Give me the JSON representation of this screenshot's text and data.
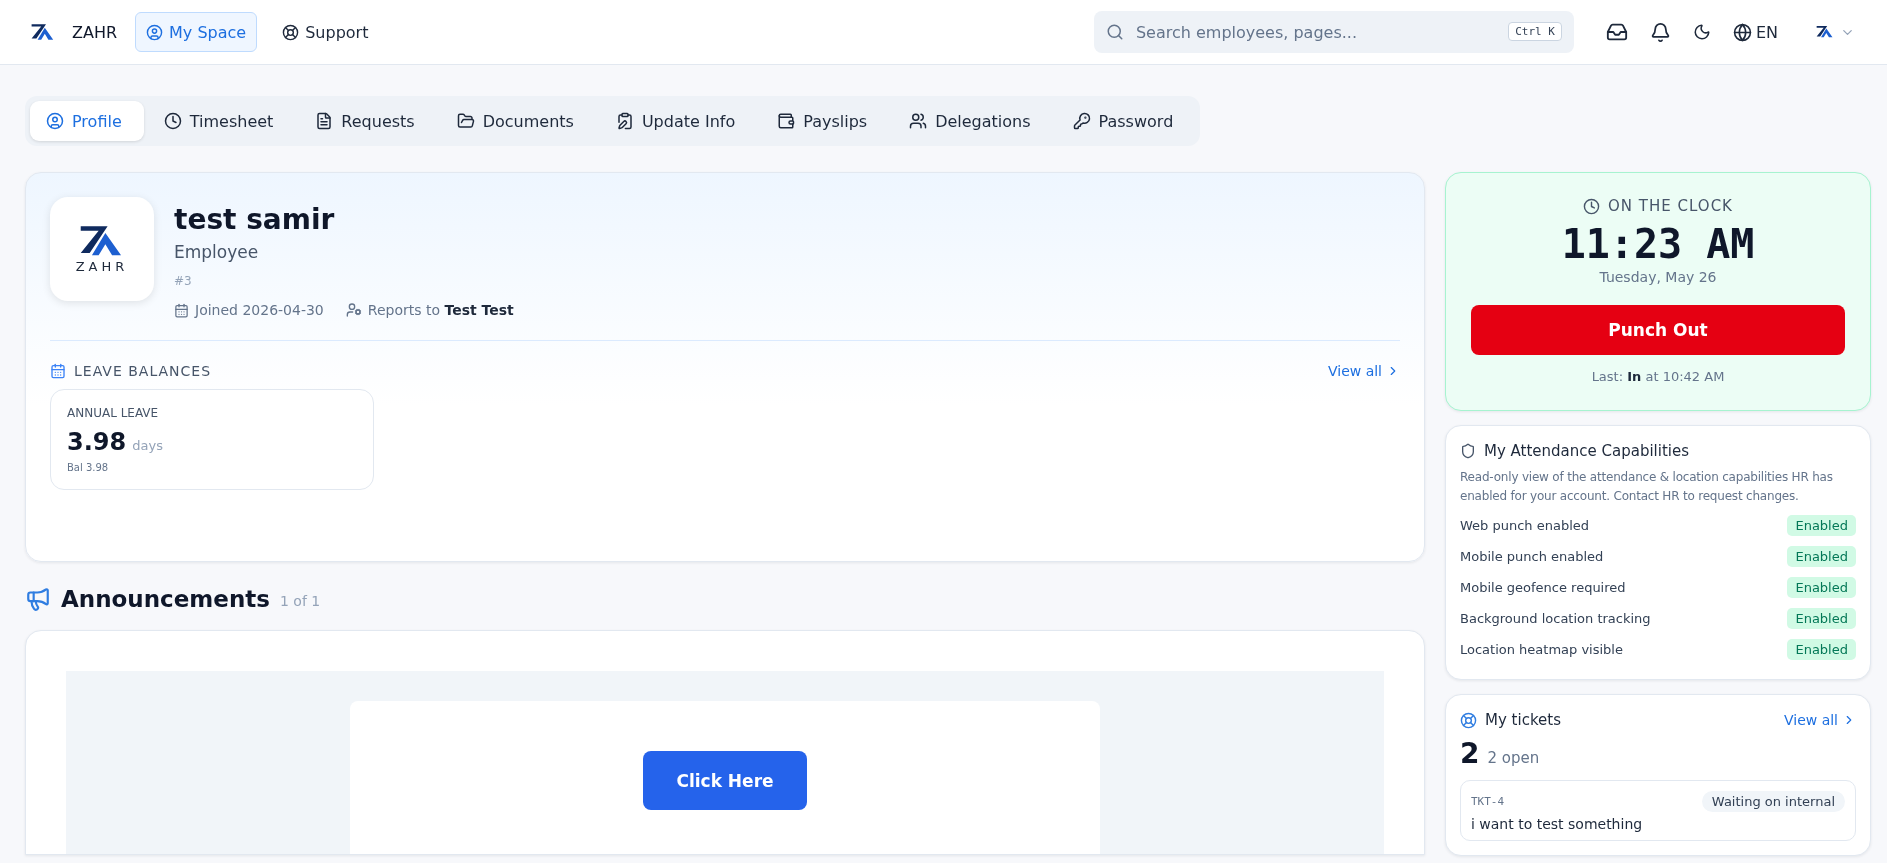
{
  "header": {
    "brand": "ZAHR",
    "nav": [
      {
        "label": "My Space",
        "selected": true,
        "kind": "user"
      },
      {
        "label": "Support",
        "selected": false,
        "kind": "support"
      }
    ],
    "search": {
      "placeholder": "Search employees, pages...",
      "shortcut": "Ctrl K"
    },
    "language": "EN"
  },
  "tabs": [
    {
      "label": "Profile",
      "selected": true,
      "kind": "profile"
    },
    {
      "label": "Timesheet",
      "selected": false,
      "kind": "timesheet"
    },
    {
      "label": "Requests",
      "selected": false,
      "kind": "requests"
    },
    {
      "label": "Documents",
      "selected": false,
      "kind": "documents"
    },
    {
      "label": "Update Info",
      "selected": false,
      "kind": "update"
    },
    {
      "label": "Payslips",
      "selected": false,
      "kind": "payslips"
    },
    {
      "label": "Delegations",
      "selected": false,
      "kind": "delegations"
    },
    {
      "label": "Password",
      "selected": false,
      "kind": "password"
    }
  ],
  "profile": {
    "logo_text": "ZAHR",
    "name": "test samir",
    "role": "Employee",
    "employee_number": "#3",
    "joined": "Joined 2026-04-30",
    "reports_to": "Reports to **Test Test**"
  },
  "leave_balances": {
    "title": "LEAVE BALANCES",
    "view_all": "View all",
    "items": [
      {
        "name": "ANNUAL LEAVE",
        "value": "3.98",
        "unit": "days",
        "balance": "Bal 3.98"
      }
    ]
  },
  "announcements": {
    "title": "Announcements",
    "count": "1 of 1",
    "button": "Click Here"
  },
  "clock": {
    "title": "ON THE CLOCK",
    "time": "11:23 AM",
    "date": "Tuesday, May 26",
    "button": "Punch Out",
    "last": "Last: **In** at 10:42 AM"
  },
  "capabilities": {
    "title": "My Attendance Capabilities",
    "description": "Read-only view of the attendance & location capabilities HR has enabled for your account. Contact HR to request changes.",
    "items": [
      {
        "label": "Web punch enabled",
        "status": "Enabled",
        "enabled": true
      },
      {
        "label": "Mobile punch enabled",
        "status": "Enabled",
        "enabled": true
      },
      {
        "label": "Mobile geofence required",
        "status": "Enabled",
        "enabled": true
      },
      {
        "label": "Background location tracking",
        "status": "Enabled",
        "enabled": true
      },
      {
        "label": "Location heatmap visible",
        "status": "Enabled",
        "enabled": true
      }
    ]
  },
  "tickets": {
    "title": "My tickets",
    "view_all": "View all",
    "count": "2",
    "open": "2 open",
    "items": [
      {
        "id": "TKT-4",
        "status": "Waiting on internal",
        "subject": "i want to test something"
      }
    ]
  }
}
